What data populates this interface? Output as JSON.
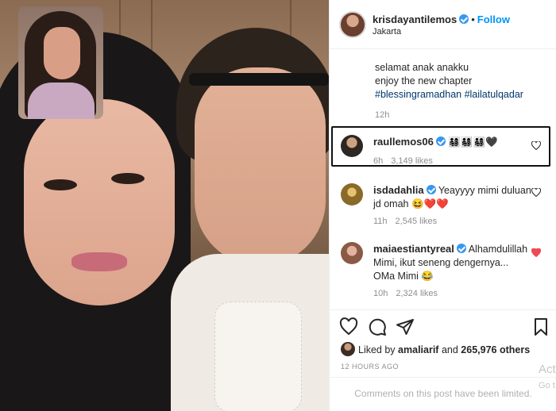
{
  "post": {
    "username": "krisdayantilemos",
    "verified": true,
    "follow_label": "Follow",
    "location": "Jakarta"
  },
  "caption": {
    "lines": [
      "selamat anak anakku",
      "enjoy the new chapter"
    ],
    "hashtags": "#blessingramadhan #lailatulqadar",
    "time": "12h"
  },
  "comments": [
    {
      "username": "raullemos06",
      "verified": true,
      "text": "👨‍👩‍👧‍👦👨‍👩‍👧‍👦👨‍👩‍👧‍👦🖤",
      "time": "6h",
      "likes": "3,149 likes",
      "highlighted": true,
      "liked": false
    },
    {
      "username": "isdadahlia",
      "verified": true,
      "text": "Yeayyyy mimi duluan jd omah 😆❤️❤️",
      "time": "11h",
      "likes": "2,545 likes",
      "liked": false
    },
    {
      "username": "maiaestiantyreal",
      "verified": true,
      "text": "Alhamdulillah Mimi, ikut seneng dengernya... OMa Mimi 😂",
      "time": "10h",
      "likes": "2,324 likes",
      "liked": true
    }
  ],
  "actions": {
    "like": "heart-icon",
    "comment": "comment-icon",
    "share": "share-icon",
    "save": "bookmark-icon"
  },
  "likes": {
    "prefix": "Liked by",
    "user": "amaliarif",
    "mid": "and",
    "others": "265,976 others"
  },
  "posted_ago": "12 HOURS AGO",
  "comments_limited": "Comments on this post have been limited.",
  "watermark": {
    "line1": "Acti",
    "line2": "Go t"
  },
  "colors": {
    "link": "#0095f6",
    "hashtag": "#00376b",
    "verified": "#3897f0",
    "liked_heart": "#ed4956",
    "muted": "#8e8e8e"
  }
}
